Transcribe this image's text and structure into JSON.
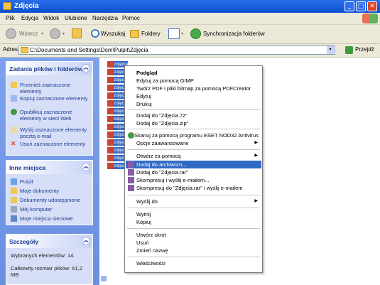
{
  "window": {
    "title": "Zdjęcia"
  },
  "menu": [
    "Plik",
    "Edycja",
    "Widok",
    "Ulubione",
    "Narzędzia",
    "Pomoc"
  ],
  "toolbar": {
    "back_label": "Wstecz",
    "search_label": "Wyszukaj",
    "folders_label": "Foldery",
    "sync_label": "Synchronizacja folderów"
  },
  "address": {
    "label": "Adres",
    "path": "C:\\Documents and Settings\\Dom\\Pulpit\\Zdjęcia",
    "go_label": "Przejdź"
  },
  "tasks_panel": {
    "title": "Zadania plików i folderów",
    "items": [
      "Przenieś zaznaczone elementy",
      "Kopiuj zaznaczone elementy",
      "Opublikuj zaznaczone elementy w sieci Web",
      "Wyślij zaznaczone elementy pocztą e-mail",
      "Usuń zaznaczone elementy"
    ]
  },
  "places_panel": {
    "title": "Inne miejsca",
    "items": [
      "Pulpit",
      "Moje dokumenty",
      "Dokumenty udostępnione",
      "Mój komputer",
      "Moje miejsca sieciowe"
    ]
  },
  "details_panel": {
    "title": "Szczegóły",
    "selected": "Wybranych elementów: 14.",
    "size": "Całkowity rozmiar plików: 61,2 MB"
  },
  "files": {
    "label": "zdjęcia"
  },
  "context_menu": {
    "items": [
      "Podgląd",
      "Edytuj za pomocą GIMP",
      "Twórz PDF i pliki bitmap za pomocą PDFCreator",
      "Edytuj",
      "Drukuj",
      "Dodaj do \"Zdjęcia.7z\"",
      "Dodaj do \"Zdjęcia.zip\"",
      "Skanuj za pomocą programu ESET NOD32 Antivirus",
      "Opcje zaawansowane",
      "Otwórz za pomocą",
      "Dodaj do archiwum...",
      "Dodaj do \"Zdjęcia.rar\"",
      "Skompresuj i wyślij e-mailem...",
      "Skompresuj do \"Zdjęcia.rar\" i wyślij e-mailem",
      "Wyślij do",
      "Wytnij",
      "Kopiuj",
      "Utwórz skrót",
      "Usuń",
      "Zmień nazwę",
      "Właściwości"
    ]
  },
  "colors": {
    "title_blue": "#0b4fd1",
    "selection_blue": "#316ac5",
    "taskpane_blue": "#7da2ee"
  }
}
